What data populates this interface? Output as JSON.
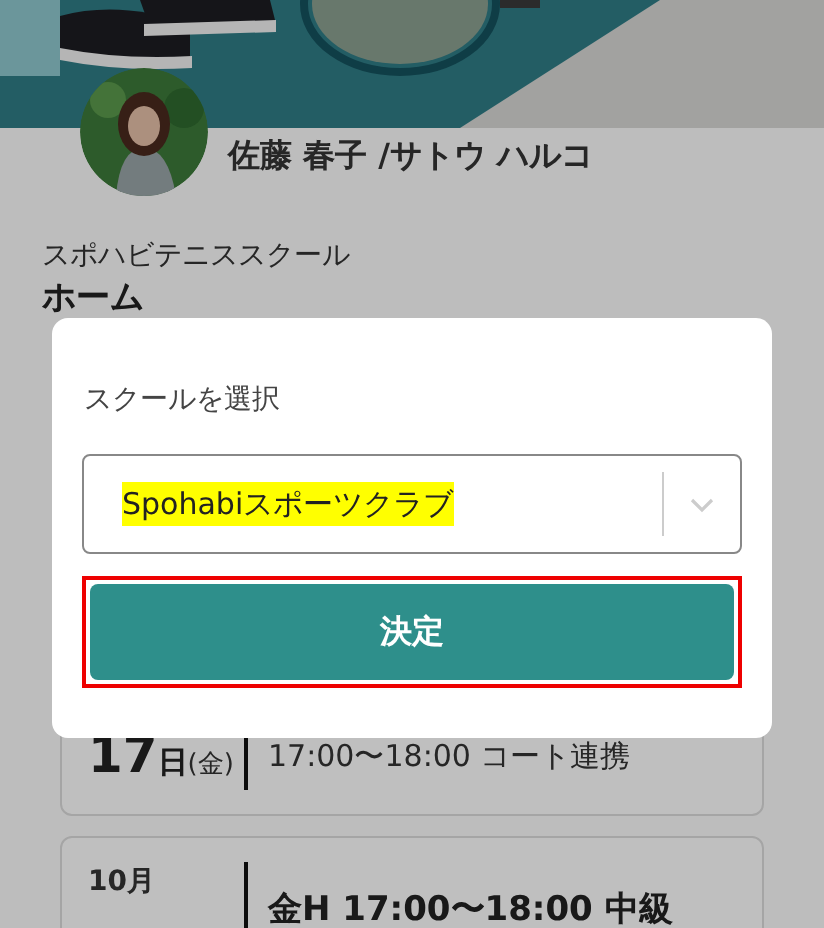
{
  "profile": {
    "name": "佐藤 春子 /サトウ ハルコ"
  },
  "school_name": "スポハビテニススクール",
  "page_title": "ホーム",
  "lessons": [
    {
      "day": "17",
      "day_unit": "日",
      "weekday": "(金)",
      "title": "17:00〜18:00 コート連携",
      "bold": false
    },
    {
      "month": "10月",
      "title": "金H 17:00〜18:00 中級",
      "bold": true
    }
  ],
  "dialog": {
    "label": "スクールを選択",
    "select": {
      "value": "Spohabiスポーツクラブ",
      "highlighted": true
    },
    "button": {
      "label": "決定",
      "highlighted": true
    }
  }
}
